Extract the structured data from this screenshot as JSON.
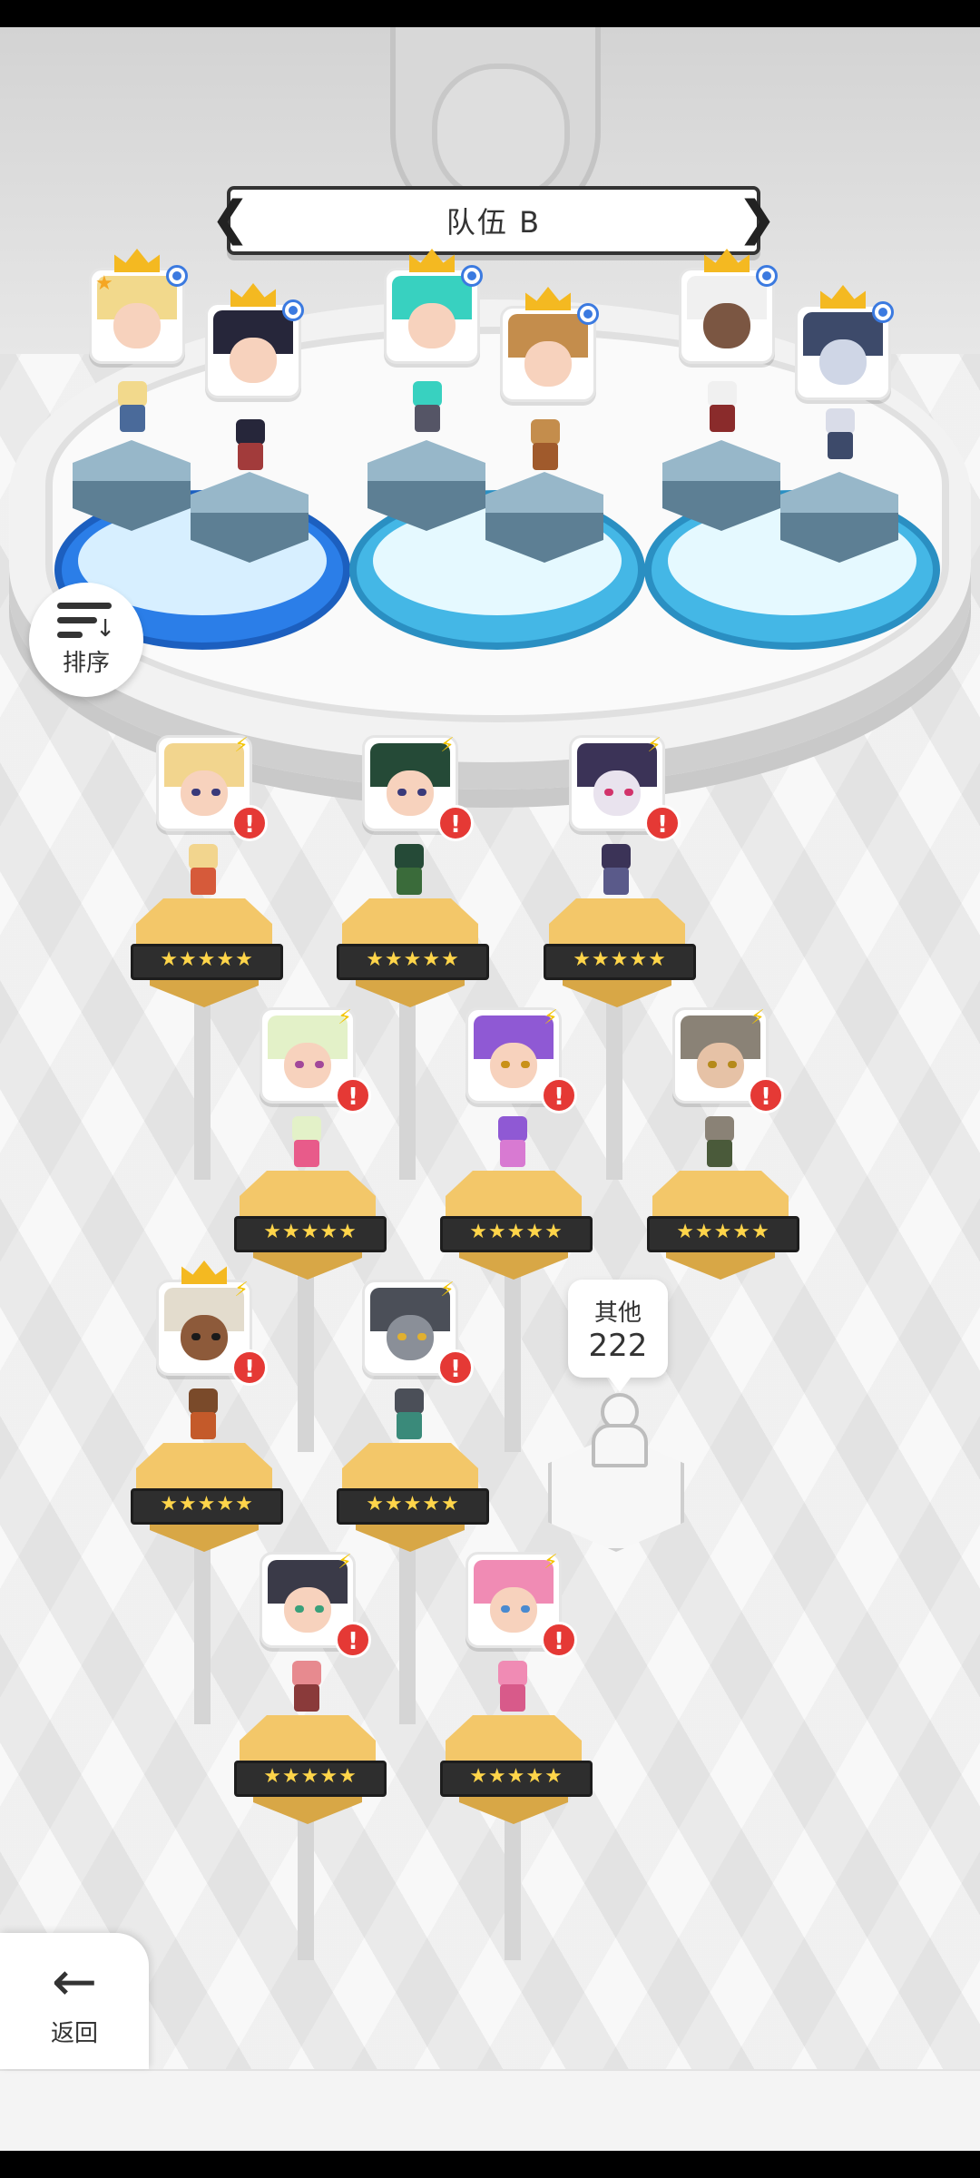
{
  "team": {
    "title": "队伍 B"
  },
  "sort_button": {
    "label": "排序",
    "icon": "sort-icon"
  },
  "back_button": {
    "label": "返回",
    "icon": "arrow-left-icon"
  },
  "others": {
    "label": "其他",
    "count": "222"
  },
  "team_members": [
    {
      "name": "blonde-knight",
      "hair": "#f2d98c",
      "crown": true,
      "leader": true
    },
    {
      "name": "dark-hair-girl",
      "hair": "#26263a",
      "crown": true,
      "leader": false
    },
    {
      "name": "teal-hair-girl",
      "hair": "#38d1c0",
      "crown": true,
      "leader": false
    },
    {
      "name": "brown-hair-boy",
      "hair": "#c48d4c",
      "crown": true,
      "leader": false
    },
    {
      "name": "white-hair-warrior",
      "hair": "#f0f0f0",
      "crown": true,
      "leader": false
    },
    {
      "name": "armored-mech",
      "hair": "#3d4a6a",
      "crown": true,
      "leader": false
    }
  ],
  "roster": [
    {
      "name": "blonde-girl",
      "hair": "#f2d58e",
      "stars": "★★★★★",
      "crown": false
    },
    {
      "name": "green-hair-girl",
      "hair": "#254a37",
      "stars": "★★★★★",
      "crown": false
    },
    {
      "name": "purple-hair-vampire",
      "hair": "#3b3357",
      "stars": "★★★★★",
      "crown": false
    },
    {
      "name": "mint-hair-girl",
      "hair": "#e3f1c8",
      "stars": "★★★★★",
      "crown": false
    },
    {
      "name": "purple-hair-girl",
      "hair": "#8f59d4",
      "stars": "★★★★★",
      "crown": false
    },
    {
      "name": "gray-hair-man",
      "hair": "#8a8276",
      "stars": "★★★★★",
      "crown": false
    },
    {
      "name": "tribal-warrior",
      "hair": "#7a4a2a",
      "stars": "★★★★★",
      "crown": true
    },
    {
      "name": "robot-soldier",
      "hair": "#4b4f58",
      "stars": "★★★★★",
      "crown": false
    },
    {
      "name": "pink-hair-captain",
      "hair": "#e78a8f",
      "stars": "★★★★★",
      "crown": false
    },
    {
      "name": "pink-hair-idol",
      "hair": "#f08bb4",
      "stars": "★★★★★",
      "crown": false
    }
  ],
  "colors": {
    "alert": "#e53935",
    "bolt": "#f3c400",
    "crown": "#f4b921",
    "pool_blue": "#2b7ee8",
    "pool_cyan": "#44b7e6",
    "gold": "#f3c769"
  }
}
